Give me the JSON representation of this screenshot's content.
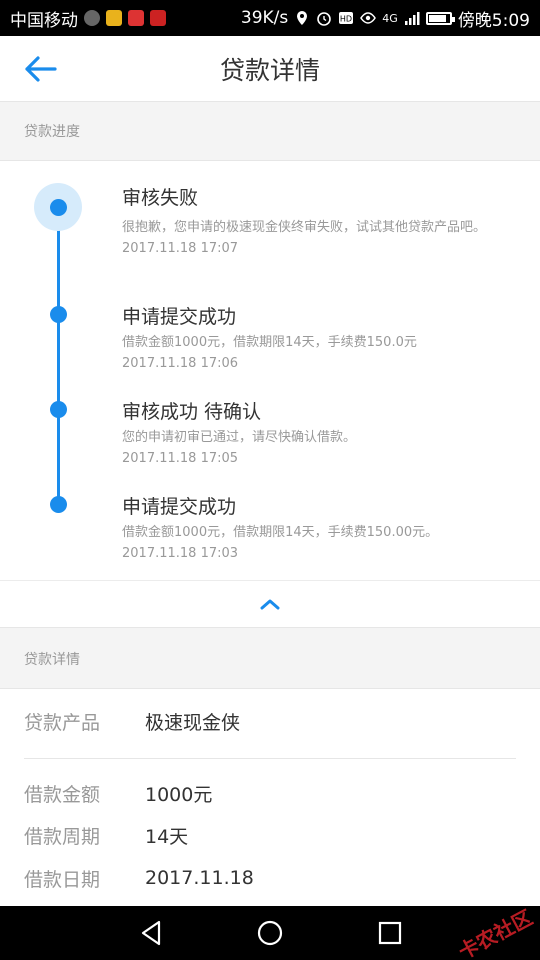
{
  "status_bar": {
    "carrier": "中国移动",
    "speed": "39K/s",
    "time": "傍晚5:09",
    "network": "4G",
    "battery_level": 0.8
  },
  "header": {
    "title": "贷款详情",
    "back_icon": "back-arrow-icon"
  },
  "progress_section": {
    "label": "贷款进度",
    "steps": [
      {
        "title": "审核失败",
        "desc": "很抱歉，您申请的极速现金侠终审失败，试试其他贷款产品吧。",
        "time": "2017.11.18 17:07"
      },
      {
        "title": "申请提交成功",
        "desc": "借款金额1000元，借款期限14天，手续费150.0元",
        "time": "2017.11.18 17:06"
      },
      {
        "title": "审核成功 待确认",
        "desc": "您的申请初审已通过，请尽快确认借款。",
        "time": "2017.11.18 17:05"
      },
      {
        "title": "申请提交成功",
        "desc": "借款金额1000元，借款期限14天，手续费150.00元。",
        "time": "2017.11.18 17:03"
      }
    ]
  },
  "details_section": {
    "label": "贷款详情",
    "rows": [
      {
        "label": "贷款产品",
        "value": "极速现金侠"
      },
      {
        "label": "借款金额",
        "value": "1000元"
      },
      {
        "label": "借款周期",
        "value": "14天"
      },
      {
        "label": "借款日期",
        "value": "2017.11.18"
      }
    ]
  },
  "watermark": "卡农社区",
  "colors": {
    "accent": "#1a8cec",
    "text_primary": "#333333",
    "text_secondary": "#999999",
    "background": "#f4f4f4"
  }
}
